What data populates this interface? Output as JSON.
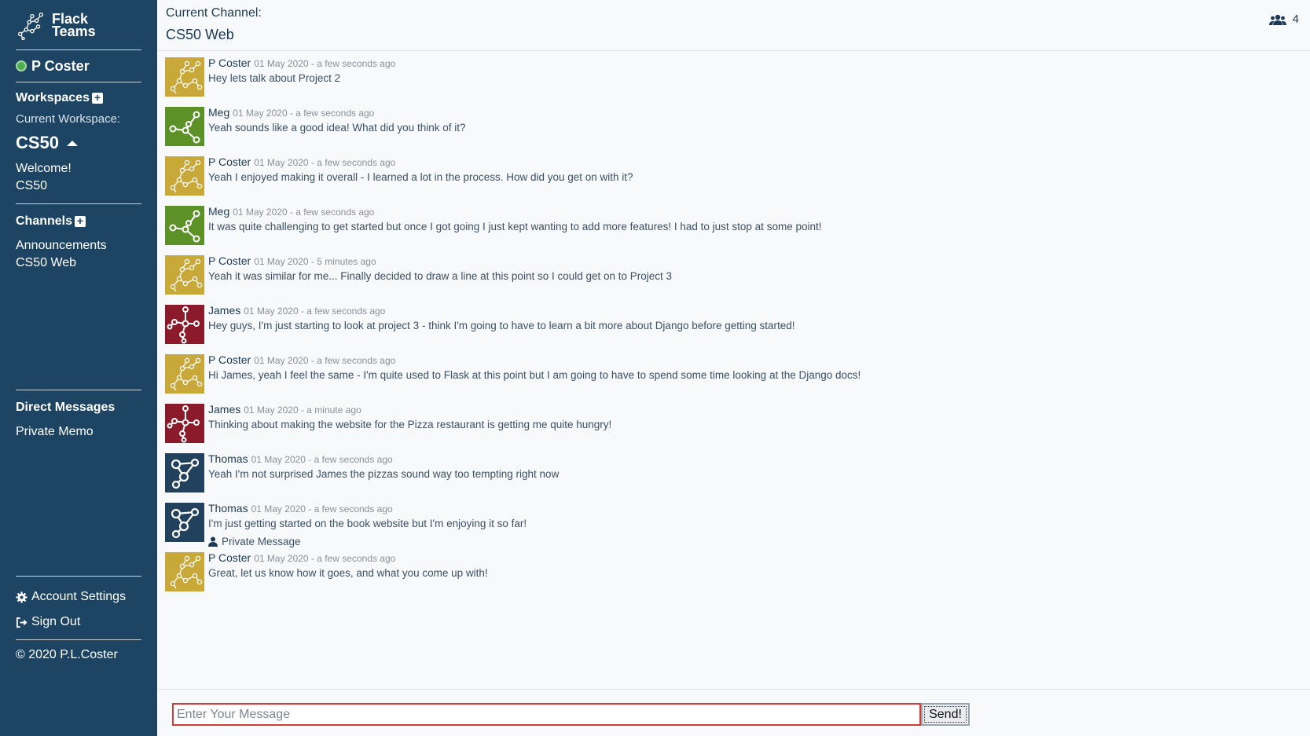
{
  "brand": {
    "line1": "Flack",
    "line2": "Teams"
  },
  "user": {
    "name": "P Coster"
  },
  "workspaces": {
    "heading": "Workspaces",
    "current_label": "Current Workspace:",
    "current": "CS50",
    "items": [
      "Welcome!",
      "CS50"
    ]
  },
  "channels": {
    "heading": "Channels",
    "items": [
      "Announcements",
      "CS50 Web"
    ]
  },
  "direct_messages": {
    "heading": "Direct Messages",
    "items": [
      "Private Memo"
    ]
  },
  "settings": {
    "account": "Account Settings",
    "signout": "Sign Out"
  },
  "footer": {
    "copyright": "© 2020 P.L.Coster"
  },
  "channel": {
    "label": "Current Channel:",
    "name": "CS50 Web",
    "member_count": "4"
  },
  "avatar_colors": {
    "pcoster": "#c9a83a",
    "meg": "#5c9128",
    "james": "#8b1a2b",
    "thomas": "#21415c"
  },
  "messages": [
    {
      "author": "P Coster",
      "avatar": "pcoster",
      "date": "01 May 2020 - a few seconds ago",
      "text": "Hey lets talk about Project 2"
    },
    {
      "author": "Meg",
      "avatar": "meg",
      "date": "01 May 2020 - a few seconds ago",
      "text": "Yeah sounds like a good idea! What did you think of it?"
    },
    {
      "author": "P Coster",
      "avatar": "pcoster",
      "date": "01 May 2020 - a few seconds ago",
      "text": "Yeah I enjoyed making it overall - I learned a lot in the process. How did you get on with it?"
    },
    {
      "author": "Meg",
      "avatar": "meg",
      "date": "01 May 2020 - a few seconds ago",
      "text": "It was quite challenging to get started but once I got going I just kept wanting to add more features! I had to just stop at some point!"
    },
    {
      "author": "P Coster",
      "avatar": "pcoster",
      "date": "01 May 2020 - 5 minutes ago",
      "text": "Yeah it was similar for me... Finally decided to draw a line at this point so I could get on to Project 3"
    },
    {
      "author": "James",
      "avatar": "james",
      "date": "01 May 2020 - a few seconds ago",
      "text": "Hey guys, I'm just starting to look at project 3 - think I'm going to have to learn a bit more about Django before getting started!"
    },
    {
      "author": "P Coster",
      "avatar": "pcoster",
      "date": "01 May 2020 - a few seconds ago",
      "text": "Hi James, yeah I feel the same - I'm quite used to Flask at this point but I am going to have to spend some time looking at the Django docs!"
    },
    {
      "author": "James",
      "avatar": "james",
      "date": "01 May 2020 - a minute ago",
      "text": "Thinking about making the website for the Pizza restaurant is getting me quite hungry!"
    },
    {
      "author": "Thomas",
      "avatar": "thomas",
      "date": "01 May 2020 - a few seconds ago",
      "text": "Yeah I'm not surprised James the pizzas sound way too tempting right now"
    },
    {
      "author": "Thomas",
      "avatar": "thomas",
      "date": "01 May 2020 - a few seconds ago",
      "text": "I'm just getting started on the book website but I'm enjoying it so far!",
      "private_message": "Private Message"
    },
    {
      "author": "P Coster",
      "avatar": "pcoster",
      "date": "01 May 2020 - a few seconds ago",
      "text": "Great, let us know how it goes, and what you come up with!"
    }
  ],
  "composer": {
    "placeholder": "Enter Your Message",
    "send_label": "Send!"
  }
}
